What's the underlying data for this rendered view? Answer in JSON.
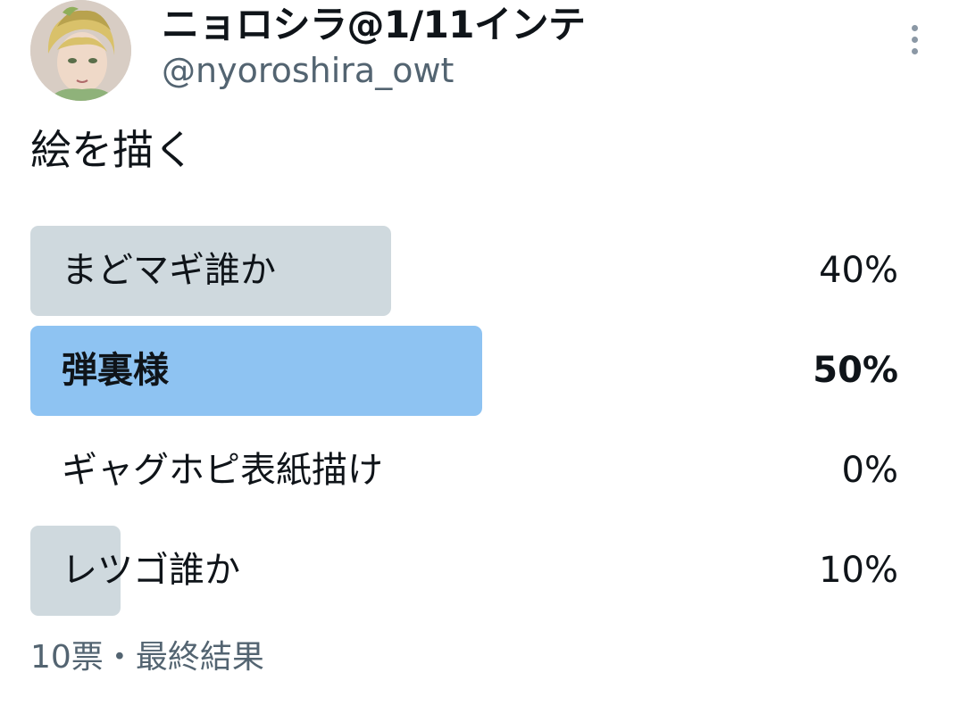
{
  "author": {
    "display_name": "ニョロシラ@1/11インテ",
    "handle": "@nyoroshira_owt",
    "avatar_icon": "avatar-illustration-icon"
  },
  "tweet": {
    "text": "絵を描く"
  },
  "poll": {
    "options": [
      {
        "label": "まどマギ誰か",
        "percent_text": "40%",
        "percent": 40,
        "winner": false
      },
      {
        "label": "弾裏様",
        "percent_text": "50%",
        "percent": 50,
        "winner": true
      },
      {
        "label": "ギャグホピ表紙描け",
        "percent_text": "0%",
        "percent": 0,
        "winner": false
      },
      {
        "label": "レツゴ誰か",
        "percent_text": "10%",
        "percent": 10,
        "winner": false
      }
    ],
    "votes": "10票",
    "separator": "・",
    "status": "最終結果"
  },
  "colors": {
    "bar_default": "#cfd9de",
    "bar_winner": "#8ec3f2",
    "text_primary": "#0f1419",
    "text_secondary": "#536471"
  },
  "icons": {
    "more": "more-vertical-icon"
  }
}
